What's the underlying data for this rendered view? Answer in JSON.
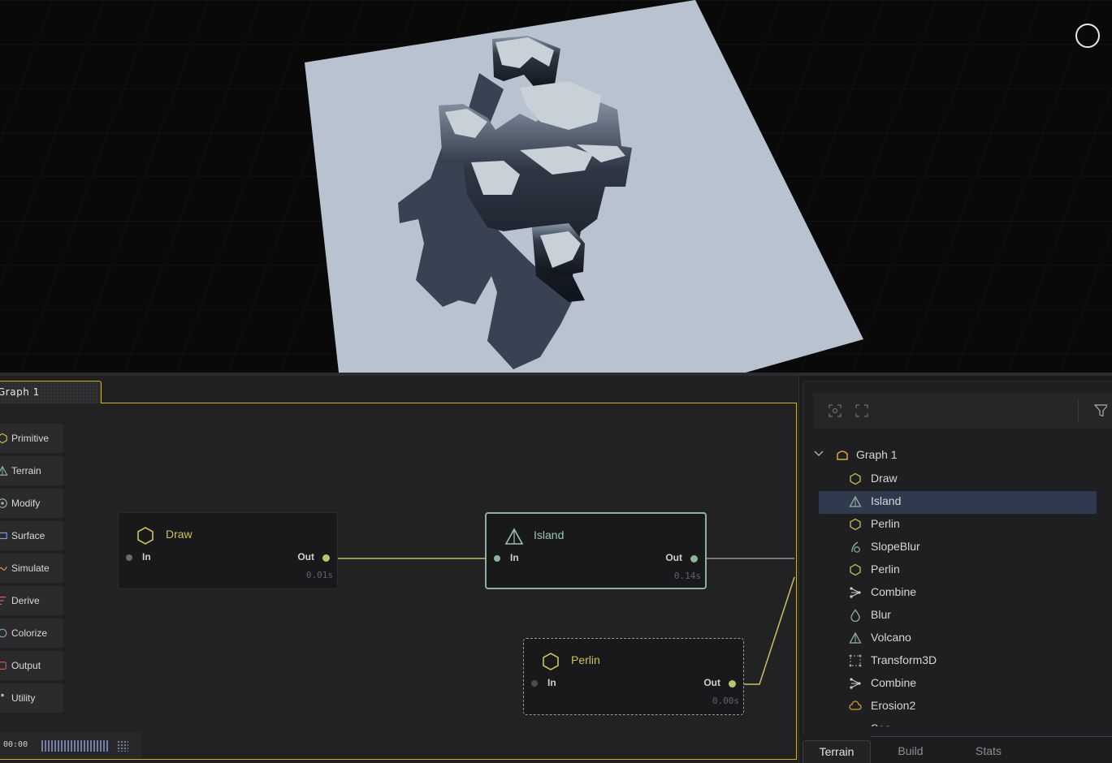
{
  "graph_tab": {
    "label": "Graph 1"
  },
  "palette": [
    {
      "label": "Primitive",
      "icon": "hexagon-icon",
      "color": "#c8c35a"
    },
    {
      "label": "Terrain",
      "icon": "mountain-icon",
      "color": "#8fb39a"
    },
    {
      "label": "Modify",
      "icon": "modify-icon",
      "color": "#8fb39a"
    },
    {
      "label": "Surface",
      "icon": "surface-icon",
      "color": "#7ea0d6"
    },
    {
      "label": "Simulate",
      "icon": "simulate-icon",
      "color": "#d49a3c"
    },
    {
      "label": "Derive",
      "icon": "derive-icon",
      "color": "#d46060"
    },
    {
      "label": "Colorize",
      "icon": "colorize-icon",
      "color": "#8aa0b8"
    },
    {
      "label": "Output",
      "icon": "output-icon",
      "color": "#d45050"
    },
    {
      "label": "Utility",
      "icon": "utility-icon",
      "color": "#bbbbbb"
    }
  ],
  "timeline": {
    "time": "00:00"
  },
  "nodes": {
    "draw": {
      "title": "Draw",
      "in": "In",
      "out": "Out",
      "time": "0.01s",
      "title_color": "#c8c35a"
    },
    "island": {
      "title": "Island",
      "in": "In",
      "out": "Out",
      "time": "0.14s",
      "title_color": "#9cc3b2"
    },
    "perlin": {
      "title": "Perlin",
      "in": "In",
      "out": "Out",
      "time": "0.00s",
      "title_color": "#c8c35a"
    }
  },
  "tree": {
    "root": "Graph 1",
    "items": [
      {
        "label": "Draw",
        "icon": "hexagon-icon",
        "selected": false
      },
      {
        "label": "Island",
        "icon": "mountain-icon",
        "selected": true
      },
      {
        "label": "Perlin",
        "icon": "hexagon-icon",
        "selected": false
      },
      {
        "label": "SlopeBlur",
        "icon": "slope-icon",
        "selected": false
      },
      {
        "label": "Perlin",
        "icon": "hexagon-icon",
        "selected": false
      },
      {
        "label": "Combine",
        "icon": "combine-icon",
        "selected": false
      },
      {
        "label": "Blur",
        "icon": "drop-icon",
        "selected": false
      },
      {
        "label": "Volcano",
        "icon": "mountain-icon",
        "selected": false
      },
      {
        "label": "Transform3D",
        "icon": "transform-icon",
        "selected": false
      },
      {
        "label": "Combine",
        "icon": "combine-icon",
        "selected": false
      },
      {
        "label": "Erosion2",
        "icon": "cloud-icon",
        "selected": false
      },
      {
        "label": "Sea",
        "icon": "wave-icon",
        "selected": false
      }
    ]
  },
  "bottom_tabs": [
    "Terrain",
    "Build",
    "Stats"
  ],
  "colors": {
    "accent": "#c9b234",
    "selection": "#303a4e",
    "terrain": "#b9c3cf"
  }
}
